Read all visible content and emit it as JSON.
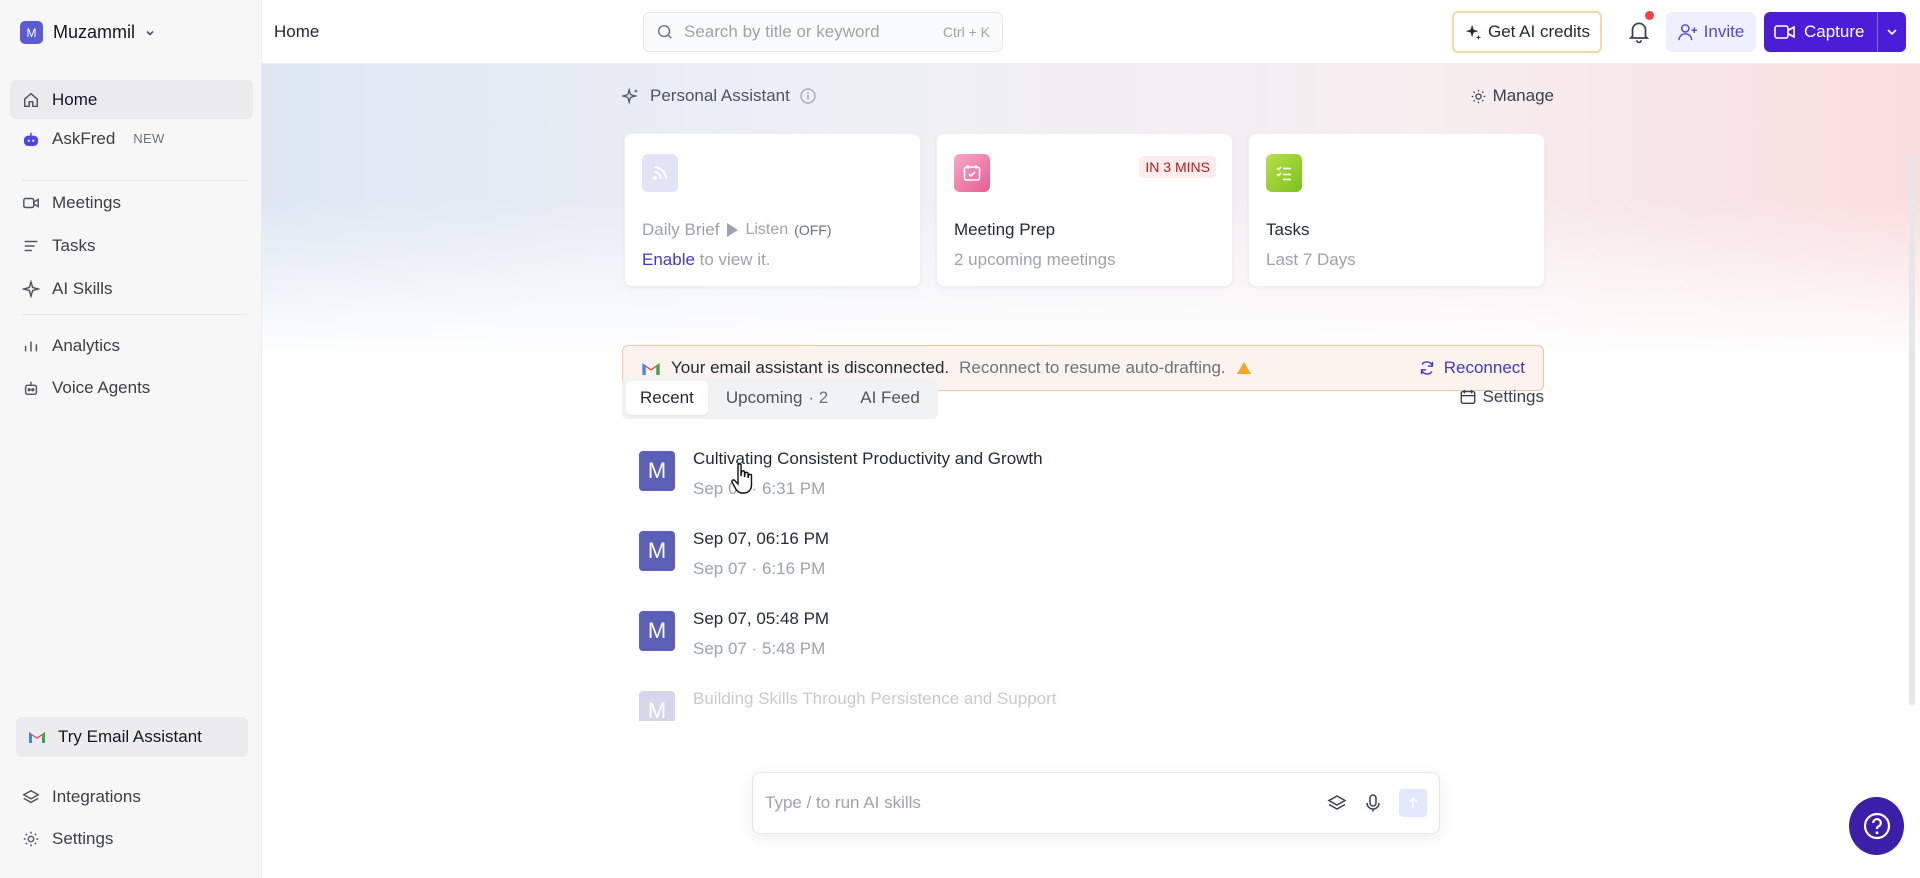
{
  "workspace": {
    "initial": "M",
    "name": "Muzammil"
  },
  "sidebar": {
    "items": [
      {
        "label": "Home",
        "icon": "home-icon"
      },
      {
        "label": "AskFred",
        "badge": "NEW",
        "icon": "bot-icon"
      },
      {
        "label": "Meetings",
        "icon": "video-icon"
      },
      {
        "label": "Tasks",
        "icon": "list-icon"
      },
      {
        "label": "AI Skills",
        "icon": "sparkle-icon"
      },
      {
        "label": "Analytics",
        "icon": "bar-chart-icon"
      },
      {
        "label": "Voice Agents",
        "icon": "voice-bot-icon"
      }
    ],
    "try_email": "Try Email Assistant",
    "bottom": [
      {
        "label": "Integrations",
        "icon": "layers-icon"
      },
      {
        "label": "Settings",
        "icon": "gear-icon"
      }
    ]
  },
  "topbar": {
    "breadcrumb": "Home",
    "search_placeholder": "Search by title or keyword",
    "search_shortcut": "Ctrl + K",
    "ai_credits": "Get AI credits",
    "invite": "Invite",
    "capture": "Capture"
  },
  "assistant": {
    "title": "Personal Assistant",
    "manage": "Manage",
    "cards": [
      {
        "title": "Daily Brief",
        "listen": "Listen",
        "listen_state": "(OFF)",
        "enable": "Enable",
        "sub_rest": " to view it."
      },
      {
        "title": "Meeting Prep",
        "sub": "2 upcoming meetings",
        "badge": "IN 3 MINS"
      },
      {
        "title": "Tasks",
        "sub": "Last 7 Days"
      }
    ]
  },
  "banner": {
    "strong": "Your email assistant is disconnected.",
    "light": "Reconnect to resume auto-drafting.",
    "action": "Reconnect"
  },
  "tabs": {
    "items": [
      {
        "label": "Recent"
      },
      {
        "label": "Upcoming",
        "count": "· 2"
      },
      {
        "label": "AI Feed"
      }
    ],
    "settings": "Settings"
  },
  "meetings": [
    {
      "avatar": "M",
      "title": "Cultivating Consistent Productivity and Growth",
      "meta": "Sep 07 · 6:31 PM"
    },
    {
      "avatar": "M",
      "title": "Sep 07, 06:16 PM",
      "meta": "Sep 07 · 6:16 PM"
    },
    {
      "avatar": "M",
      "title": "Sep 07, 05:48 PM",
      "meta": "Sep 07 · 5:48 PM"
    },
    {
      "avatar": "M",
      "title": "Building Skills Through Persistence and Support",
      "meta": ""
    }
  ],
  "composer": {
    "placeholder": "Type / to run AI skills"
  },
  "colors": {
    "brand": "#4c1dd6",
    "accent": "#4338ca",
    "warning": "#f59e0b"
  }
}
